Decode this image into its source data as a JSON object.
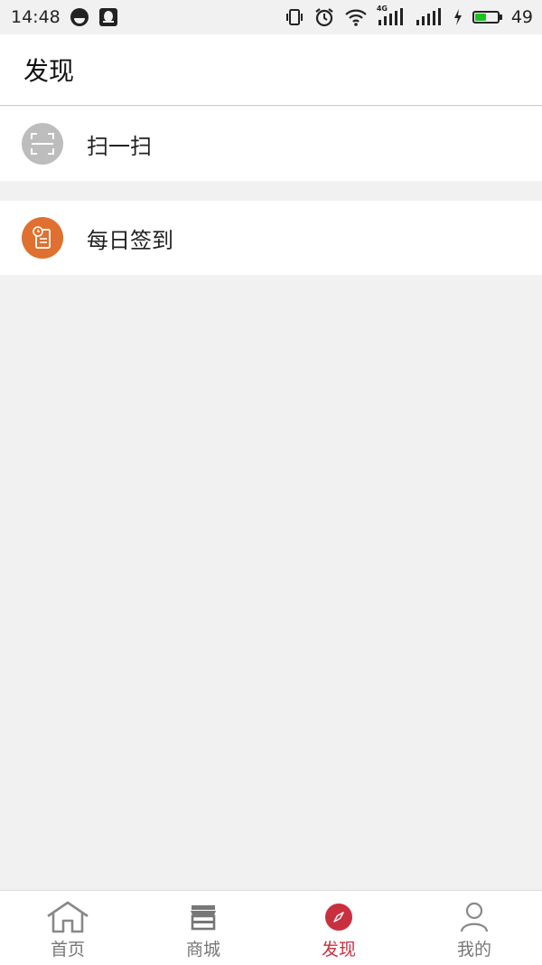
{
  "status_bar": {
    "time": "14:48",
    "network_type": "4G",
    "battery_level": "49"
  },
  "header": {
    "title": "发现"
  },
  "list": {
    "items": [
      {
        "label": "扫一扫",
        "icon": "scan-icon",
        "icon_color": "#bdbdbd"
      },
      {
        "label": "每日签到",
        "icon": "checkin-icon",
        "icon_color": "#e0702f"
      }
    ]
  },
  "tab_bar": {
    "active_color": "#c9303f",
    "tabs": [
      {
        "label": "首页",
        "icon": "home-icon"
      },
      {
        "label": "商城",
        "icon": "store-icon"
      },
      {
        "label": "发现",
        "icon": "compass-icon",
        "active": true
      },
      {
        "label": "我的",
        "icon": "person-icon"
      }
    ]
  }
}
